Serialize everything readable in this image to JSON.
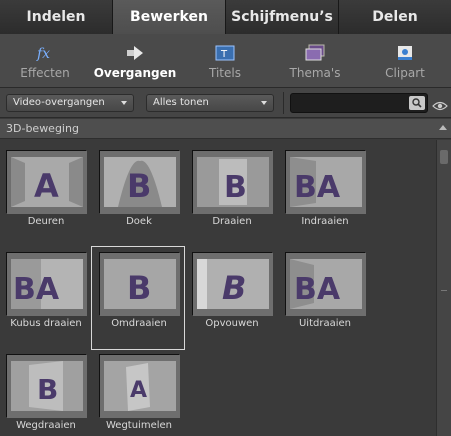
{
  "tabs": [
    "Indelen",
    "Bewerken",
    "Schijfmenu’s",
    "Delen"
  ],
  "toolbar": {
    "items": [
      "Effecten",
      "Overgangen",
      "Titels",
      "Thema's",
      "Clipart"
    ],
    "active": "Overgangen"
  },
  "filters": {
    "category": "Video-overgangen",
    "show": "Alles tonen",
    "search_value": ""
  },
  "section": {
    "title": "3D-beweging"
  },
  "transitions": [
    {
      "label": "Deuren",
      "letter": "A"
    },
    {
      "label": "Doek",
      "letter": "B"
    },
    {
      "label": "Draaien",
      "letter": "B"
    },
    {
      "label": "Indraaien",
      "letter": "BA"
    },
    {
      "label": "Kubus draaien",
      "letter": "BA"
    },
    {
      "label": "Omdraaien",
      "letter": "B"
    },
    {
      "label": "Opvouwen",
      "letter": "B"
    },
    {
      "label": "Uitdraaien",
      "letter": "BA"
    },
    {
      "label": "Wegdraaien",
      "letter": "B"
    },
    {
      "label": "Wegtuimelen",
      "letter": "A"
    }
  ],
  "selected": "Omdraaien"
}
